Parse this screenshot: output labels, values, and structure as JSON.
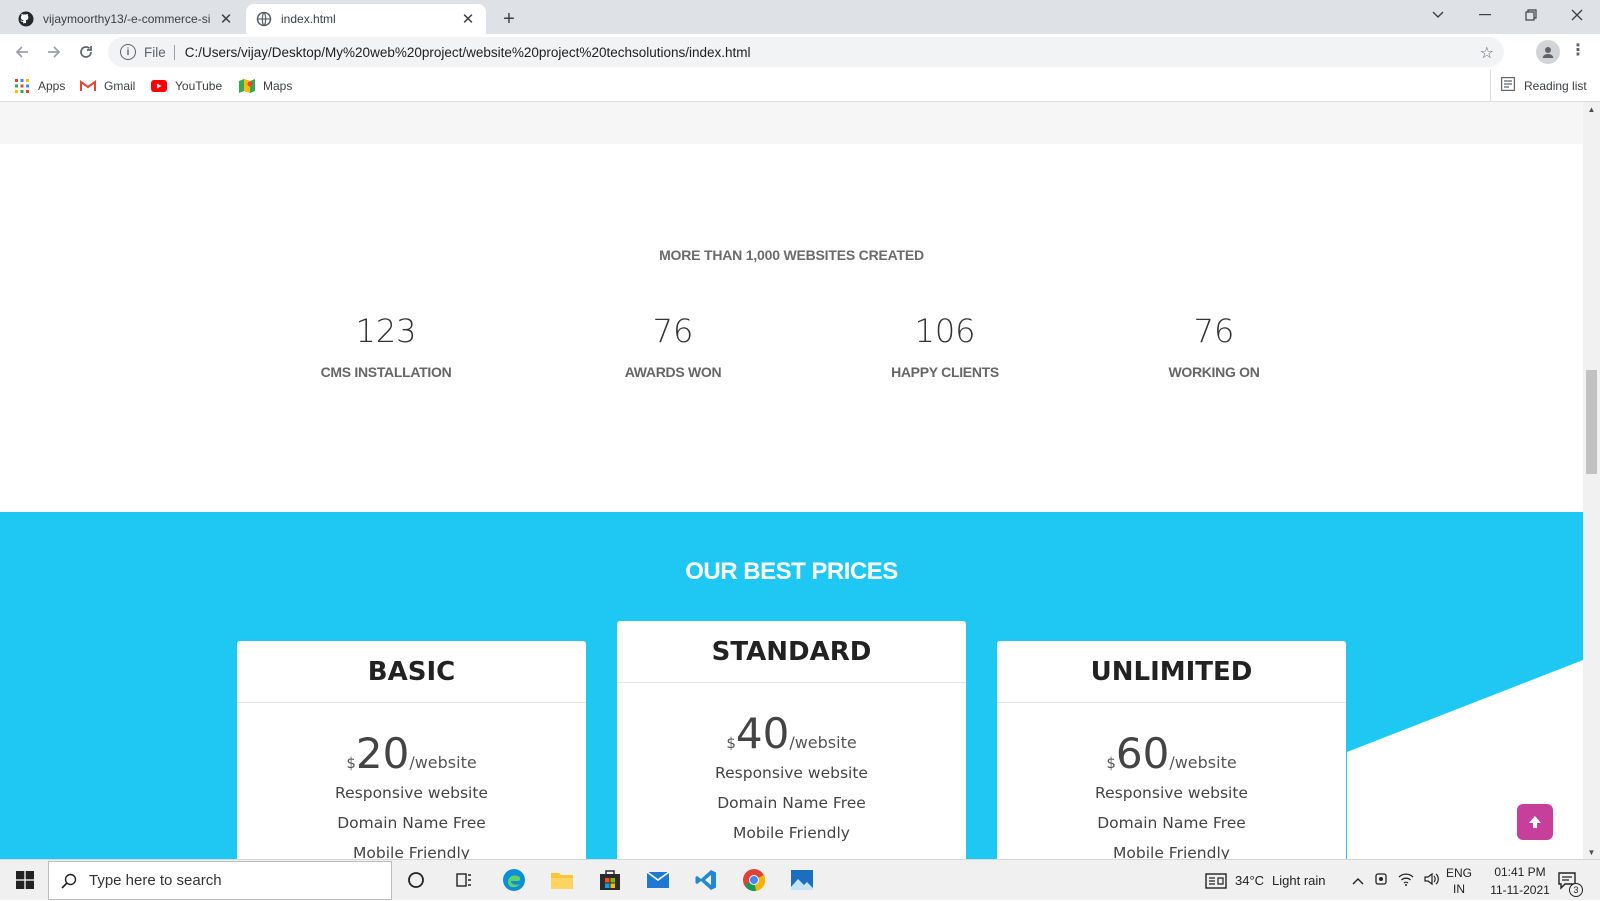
{
  "browser": {
    "tabs": [
      {
        "title": "vijaymoorthy13/-e-commerce-si",
        "icon": "github-icon",
        "active": false
      },
      {
        "title": "index.html",
        "icon": "globe-icon",
        "active": true
      }
    ],
    "address": {
      "scheme_label": "File",
      "url": "C:/Users/vijay/Desktop/My%20web%20project/website%20project%20techsolutions/index.html"
    },
    "bookmarks": [
      {
        "label": "Apps",
        "icon": "apps-grid-icon"
      },
      {
        "label": "Gmail",
        "icon": "gmail-icon"
      },
      {
        "label": "YouTube",
        "icon": "youtube-icon"
      },
      {
        "label": "Maps",
        "icon": "maps-icon"
      }
    ],
    "reading_list": "Reading list"
  },
  "page": {
    "counter_heading": "MORE THAN 1,000 WEBSITES CREATED",
    "stats": [
      {
        "value": "123",
        "label": "CMS INSTALLATION"
      },
      {
        "value": "76",
        "label": "AWARDS WON"
      },
      {
        "value": "106",
        "label": "HAPPY CLIENTS"
      },
      {
        "value": "76",
        "label": "WORKING ON"
      }
    ],
    "prices_heading": "OUR BEST PRICES",
    "plans": [
      {
        "name": "BASIC",
        "currency": "$",
        "amount": "20",
        "per": "/website",
        "features": [
          "Responsive website",
          "Domain Name Free",
          "Mobile Friendly"
        ]
      },
      {
        "name": "STANDARD",
        "currency": "$",
        "amount": "40",
        "per": "/website",
        "features": [
          "Responsive website",
          "Domain Name Free",
          "Mobile Friendly"
        ]
      },
      {
        "name": "UNLIMITED",
        "currency": "$",
        "amount": "60",
        "per": "/website",
        "features": [
          "Responsive website",
          "Domain Name Free",
          "Mobile Friendly"
        ]
      }
    ],
    "colors": {
      "prices_bg": "#1ec8f3",
      "back_to_top": "#c53f9b"
    }
  },
  "taskbar": {
    "search_placeholder": "Type here to search",
    "weather": {
      "temp": "34°C",
      "condition": "Light rain"
    },
    "lang": {
      "line1": "ENG",
      "line2": "IN"
    },
    "time": "01:41 PM",
    "date": "11-11-2021",
    "notifications": "3"
  }
}
